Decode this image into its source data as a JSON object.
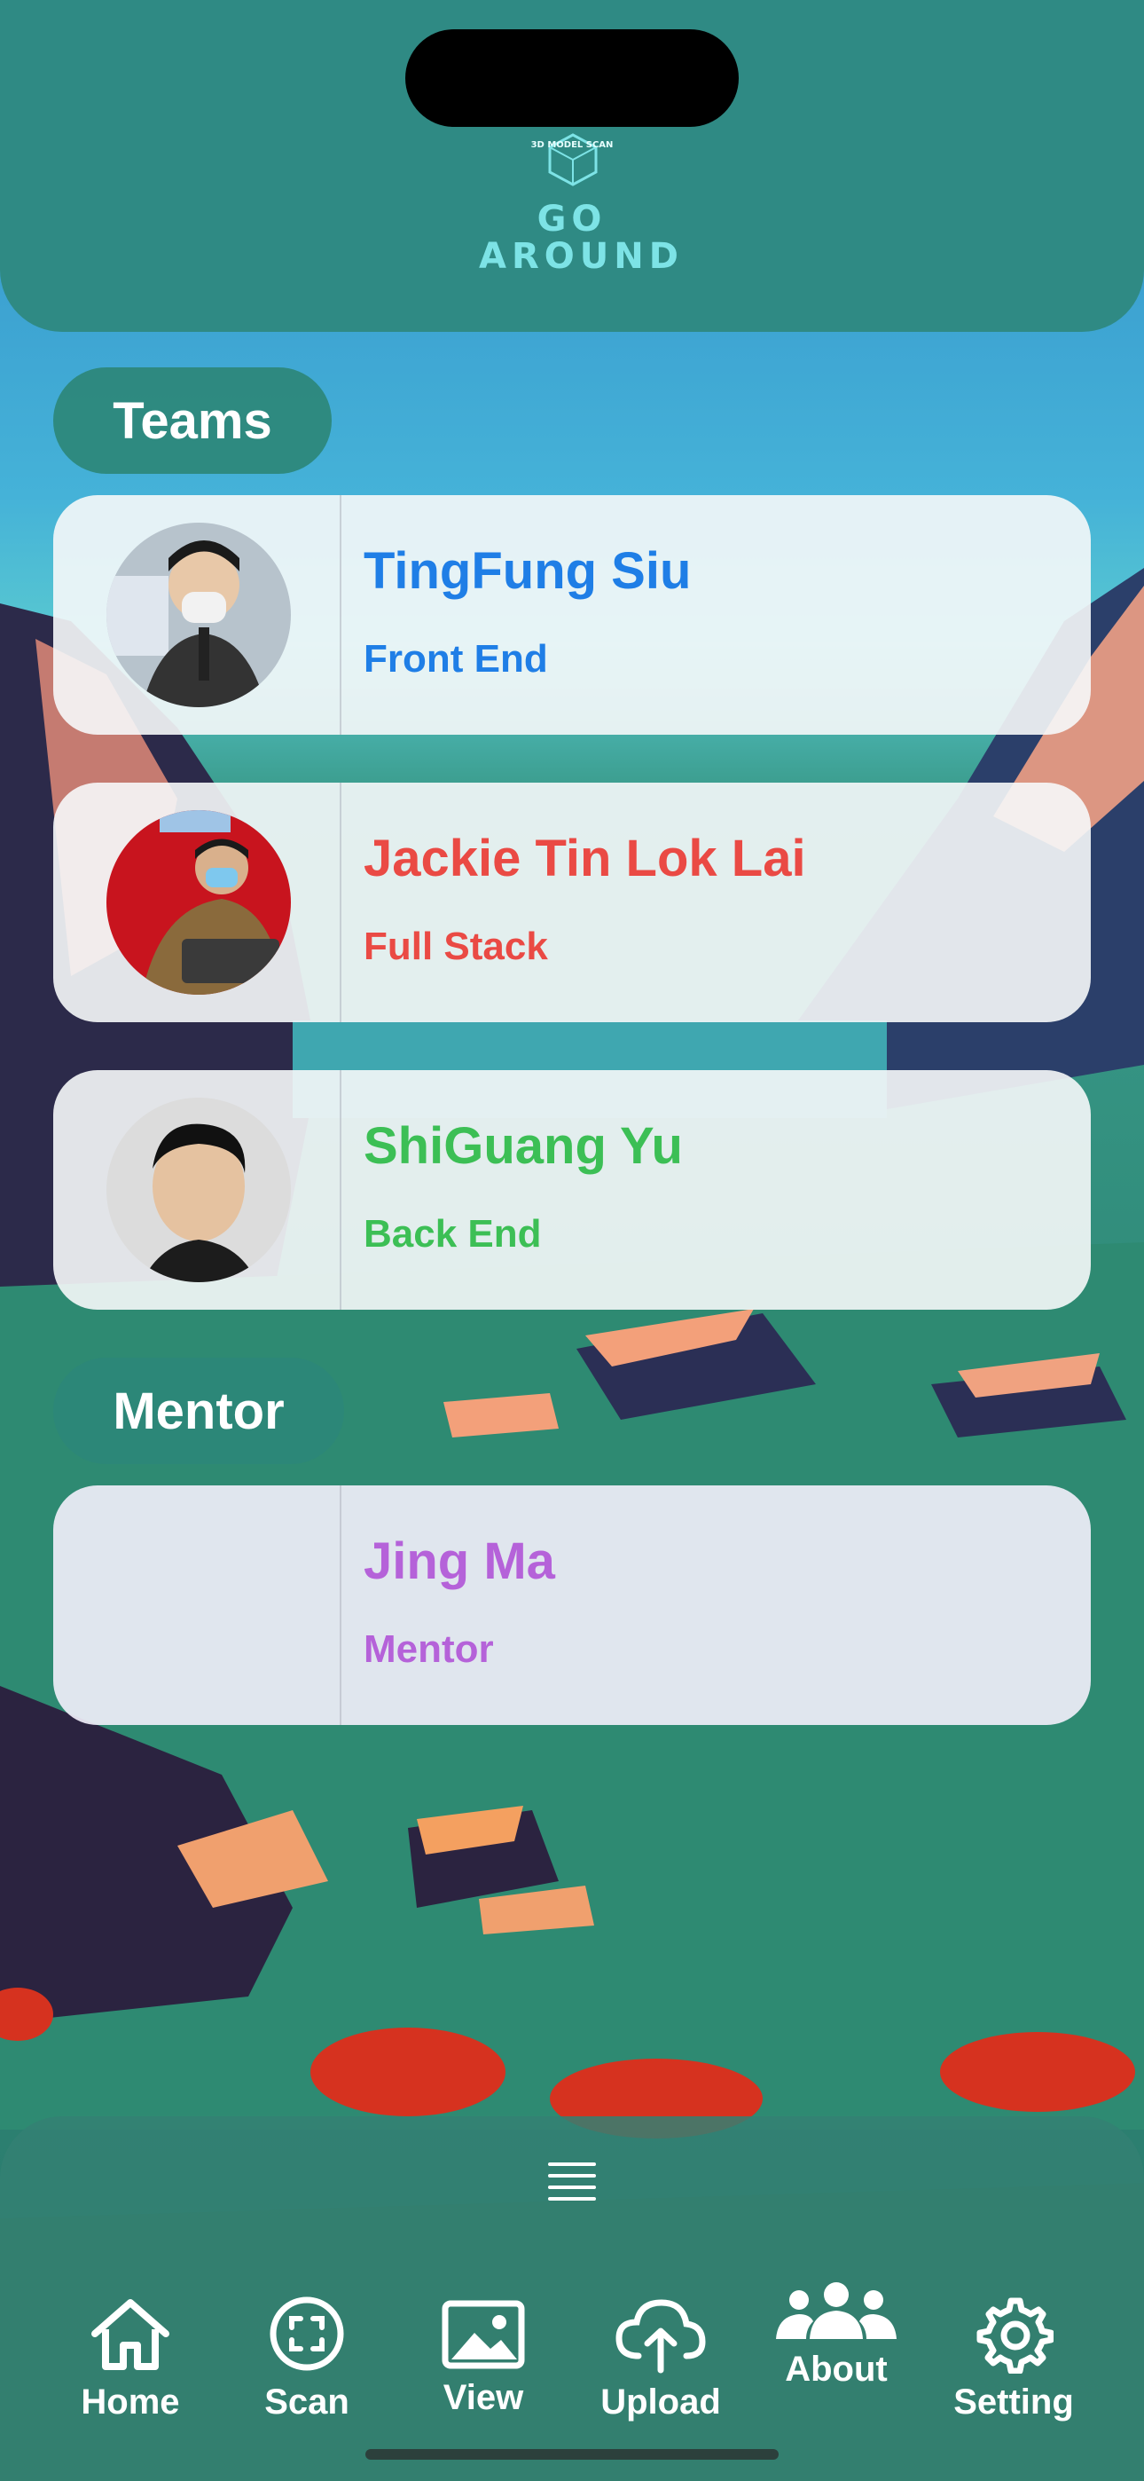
{
  "header": {
    "logo_small_text": "3D MODEL SCAN",
    "logo_line1": "GO",
    "logo_line2": "AROUND"
  },
  "sections": {
    "teams_label": "Teams",
    "mentor_label": "Mentor"
  },
  "team": [
    {
      "name": "TingFung Siu",
      "role": "Front End",
      "color": "#1f7ee6"
    },
    {
      "name": "Jackie Tin Lok Lai",
      "role": "Full Stack",
      "color": "#ea4a44"
    },
    {
      "name": "ShiGuang Yu",
      "role": "Back End",
      "color": "#3cbf55"
    }
  ],
  "mentor": {
    "name": "Jing Ma",
    "role": "Mentor",
    "color": "#b562d9"
  },
  "tabbar": {
    "items": [
      {
        "label": "Home",
        "icon": "house-icon"
      },
      {
        "label": "Scan",
        "icon": "viewfinder-icon"
      },
      {
        "label": "View",
        "icon": "photo-icon"
      },
      {
        "label": "Upload",
        "icon": "cloud-upload-icon"
      },
      {
        "label": "About",
        "icon": "people-icon"
      },
      {
        "label": "Setting",
        "icon": "gear-icon"
      }
    ]
  }
}
